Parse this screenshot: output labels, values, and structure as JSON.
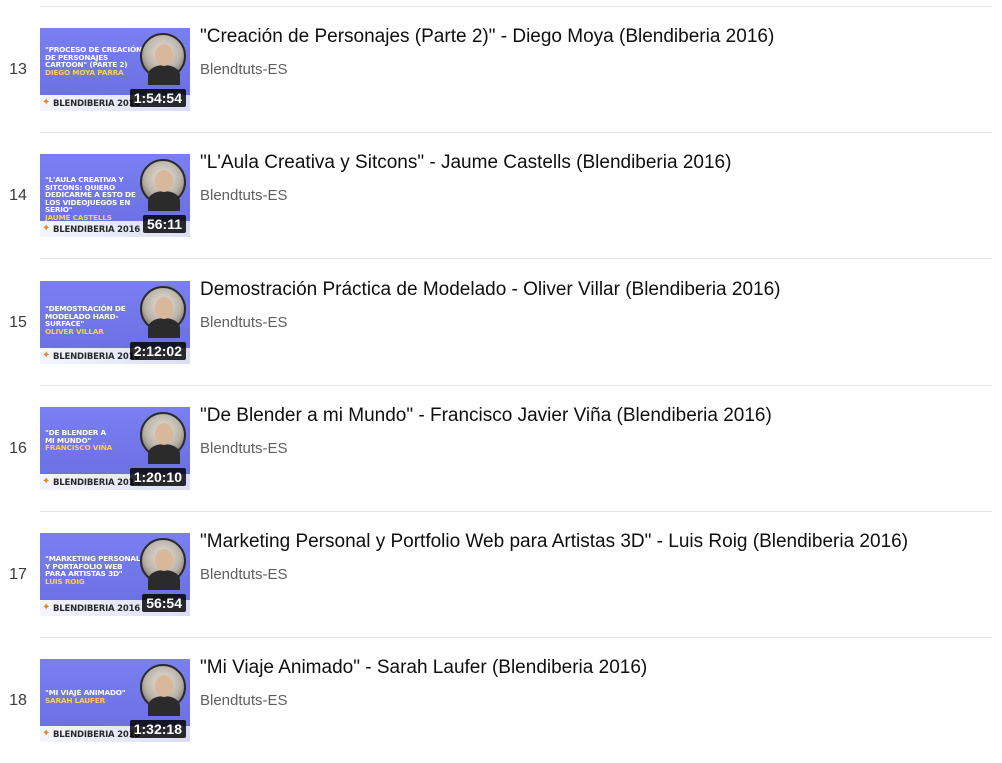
{
  "playlist": {
    "items": [
      {
        "index": "13",
        "title": "\"Creación de Personajes (Parte 2)\" - Diego Moya (Blendiberia 2016)",
        "channel": "Blendtuts-ES",
        "duration": "1:54:54",
        "thumb_title": "\"PROCESO DE CREACIÓN DE PERSONAJES CARTOON\" (PARTE 2)",
        "thumb_speaker": "DIEGO MOYA PARRA",
        "thumb_brand": "BLENDIBERIA 2016"
      },
      {
        "index": "14",
        "title": "\"L'Aula Creativa y Sitcons\" - Jaume Castells (Blendiberia 2016)",
        "channel": "Blendtuts-ES",
        "duration": "56:11",
        "thumb_title": "\"L'AULA CREATIVA Y SITCONS: QUIERO DEDICARME A ESTO DE LOS VIDEOJUEGOS EN SERIO\"",
        "thumb_speaker": "JAUME CASTELLS",
        "thumb_brand": "BLENDIBERIA 2016"
      },
      {
        "index": "15",
        "title": "Demostración Práctica de Modelado - Oliver Villar (Blendiberia 2016)",
        "channel": "Blendtuts-ES",
        "duration": "2:12:02",
        "thumb_title": "\"DEMOSTRACIÓN DE MODELADO HARD-SURFACE\"",
        "thumb_speaker": "OLIVER VILLAR",
        "thumb_brand": "BLENDIBERIA 2016"
      },
      {
        "index": "16",
        "title": "\"De Blender a mi Mundo\" - Francisco Javier Viña (Blendiberia 2016)",
        "channel": "Blendtuts-ES",
        "duration": "1:20:10",
        "thumb_title": "\"DE BLENDER A MI MUNDO\"",
        "thumb_speaker": "FRANCISCO VIÑA",
        "thumb_brand": "BLENDIBERIA 2016"
      },
      {
        "index": "17",
        "title": "\"Marketing Personal y Portfolio Web para Artistas 3D\" - Luis Roig (Blendiberia 2016)",
        "channel": "Blendtuts-ES",
        "duration": "56:54",
        "thumb_title": "\"MARKETING PERSONAL Y PORTAFOLIO WEB PARA ARTISTAS 3D\"",
        "thumb_speaker": "LUIS ROIG",
        "thumb_brand": "BLENDIBERIA 2016"
      },
      {
        "index": "18",
        "title": "\"Mi Viaje Animado\" - Sarah Laufer (Blendiberia 2016)",
        "channel": "Blendtuts-ES",
        "duration": "1:32:18",
        "thumb_title": "\"MI VIAJE ANIMADO\"",
        "thumb_speaker": "SARAH LAUFER",
        "thumb_brand": "BLENDIBERIA 2016"
      }
    ]
  }
}
